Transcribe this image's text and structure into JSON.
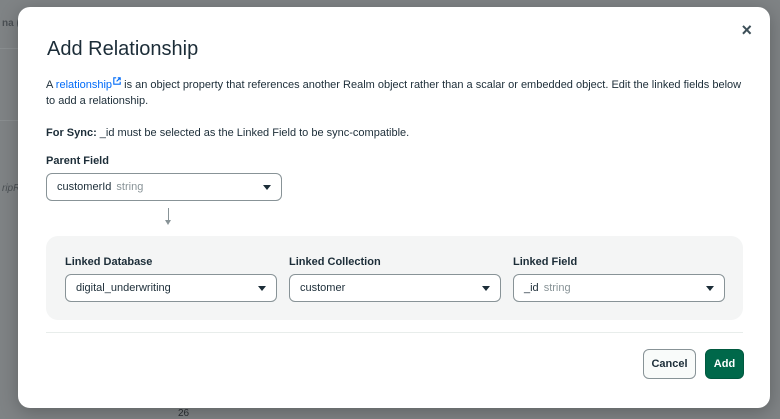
{
  "background": {
    "fragments": [
      "na (",
      "ripR",
      "26"
    ]
  },
  "modal": {
    "title": "Add Relationship",
    "close_symbol": "×",
    "description": {
      "prefix": "A ",
      "link_text": "relationship",
      "suffix": " is an object property that references another Realm object rather than a scalar or embedded object. Edit the linked fields below to add a relationship."
    },
    "sync_note": {
      "label": "For Sync:",
      "text": " _id must be selected as the Linked Field to be sync-compatible."
    },
    "parent_field": {
      "label": "Parent Field",
      "value": "customerId",
      "type": "string"
    },
    "linked_database": {
      "label": "Linked Database",
      "value": "digital_underwriting"
    },
    "linked_collection": {
      "label": "Linked Collection",
      "value": "customer"
    },
    "linked_field": {
      "label": "Linked Field",
      "value": "_id",
      "type": "string"
    },
    "buttons": {
      "cancel": "Cancel",
      "add": "Add"
    }
  },
  "colors": {
    "link": "#016bf8",
    "primary_button": "#00684a",
    "overlay": "#7f8385"
  },
  "icons": [
    "close-icon",
    "external-link-icon",
    "chevron-down-icon",
    "arrow-down-icon"
  ]
}
